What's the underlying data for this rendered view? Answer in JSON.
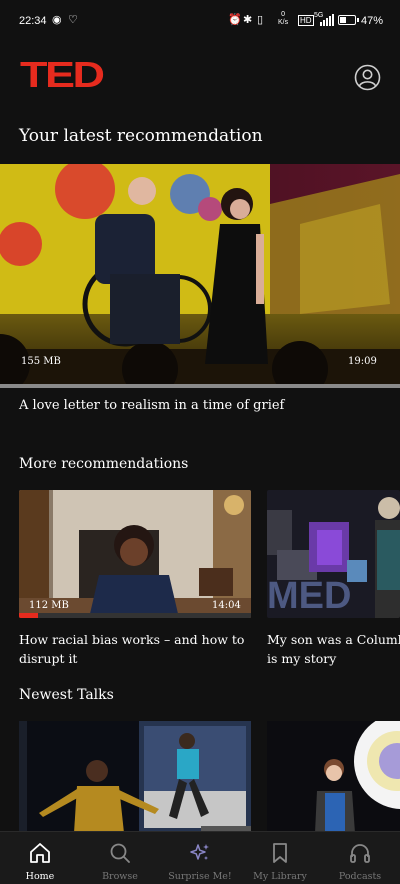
{
  "status": {
    "time": "22:34",
    "net_speed_value": "0",
    "net_speed_unit": "K/s",
    "network": "5G",
    "hd": "HD",
    "battery": "47%",
    "battery_level": 0.47
  },
  "header": {
    "logo": "TED"
  },
  "latest": {
    "title": "Your latest recommendation",
    "size": "155 MB",
    "duration": "19:09",
    "talk_title": "A love letter to realism in a time of grief"
  },
  "more": {
    "title": "More recommendations",
    "cards": [
      {
        "size": "112 MB",
        "duration": "14:04",
        "title_line1": "How racial bias works – and how to",
        "title_line2": "disrupt it",
        "progress": 0.08
      },
      {
        "title_line1": "My son was a Columb",
        "title_line2": "is my story"
      }
    ]
  },
  "newest": {
    "title": "Newest Talks"
  },
  "nav": {
    "items": [
      {
        "label": "Home",
        "icon": "home-icon",
        "active": true
      },
      {
        "label": "Browse",
        "icon": "search-icon"
      },
      {
        "label": "Surprise Me!",
        "icon": "sparkle-icon"
      },
      {
        "label": "My Library",
        "icon": "bookmark-icon"
      },
      {
        "label": "Podcasts",
        "icon": "headphones-icon"
      }
    ]
  },
  "colors": {
    "background": "#111111",
    "brand": "#e62b1e",
    "active": "#ffffff",
    "inactive": "#777777"
  }
}
